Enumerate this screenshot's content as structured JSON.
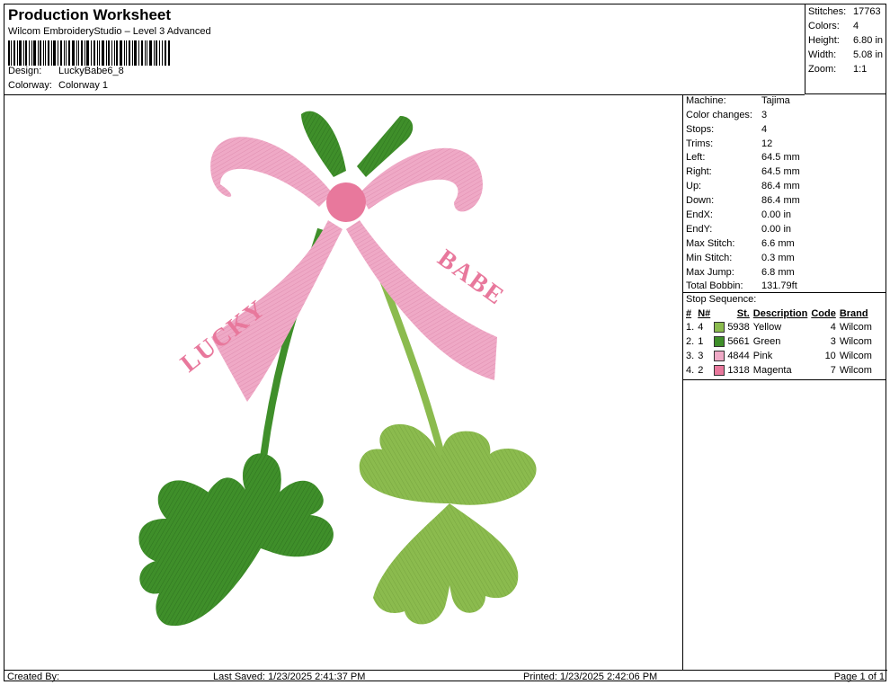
{
  "header": {
    "title": "Production Worksheet",
    "subtitle": "Wilcom EmbroideryStudio – Level 3 Advanced",
    "design_label": "Design:",
    "design_value": "LuckyBabe6_8",
    "colorway_label": "Colorway:",
    "colorway_value": "Colorway 1"
  },
  "stats": [
    {
      "label": "Stitches:",
      "value": "17763"
    },
    {
      "label": "Colors:",
      "value": "4"
    },
    {
      "label": "Height:",
      "value": "6.80 in"
    },
    {
      "label": "Width:",
      "value": "5.08 in"
    },
    {
      "label": "Zoom:",
      "value": "1:1"
    }
  ],
  "machine_info": [
    {
      "label": "Machine:",
      "value": "Tajima"
    },
    {
      "label": "Color changes:",
      "value": "3"
    },
    {
      "label": "Stops:",
      "value": "4"
    },
    {
      "label": "Trims:",
      "value": "12"
    },
    {
      "label": "Left:",
      "value": "64.5 mm"
    },
    {
      "label": "Right:",
      "value": "64.5 mm"
    },
    {
      "label": "Up:",
      "value": "86.4 mm"
    },
    {
      "label": "Down:",
      "value": "86.4 mm"
    },
    {
      "label": "EndX:",
      "value": "0.00 in"
    },
    {
      "label": "EndY:",
      "value": "0.00 in"
    },
    {
      "label": "Max Stitch:",
      "value": "6.6 mm"
    },
    {
      "label": "Min Stitch:",
      "value": "0.3 mm"
    },
    {
      "label": "Max Jump:",
      "value": "6.8 mm"
    },
    {
      "label": "Total Bobbin:",
      "value": "131.79ft"
    }
  ],
  "stop_sequence": {
    "title": "Stop Sequence:",
    "columns": [
      "#",
      "N#",
      "St.",
      "Description",
      "Code",
      "Brand"
    ],
    "rows": [
      {
        "idx": "1.",
        "n": "4",
        "color": "#8bbb4e",
        "st": "5938",
        "desc": "Yellow",
        "code": "4",
        "brand": "Wilcom"
      },
      {
        "idx": "2.",
        "n": "1",
        "color": "#3f8f2a",
        "st": "5661",
        "desc": "Green",
        "code": "3",
        "brand": "Wilcom"
      },
      {
        "idx": "3.",
        "n": "3",
        "color": "#efa9c6",
        "st": "4844",
        "desc": "Pink",
        "code": "10",
        "brand": "Wilcom"
      },
      {
        "idx": "4.",
        "n": "2",
        "color": "#e8789c",
        "st": "1318",
        "desc": "Magenta",
        "code": "7",
        "brand": "Wilcom"
      }
    ]
  },
  "design_text": {
    "left": "LUCKY",
    "right": "BABE"
  },
  "footer": {
    "created_by": "Created By:",
    "last_saved": "Last Saved: 1/23/2025 2:41:37 PM",
    "printed": "Printed: 1/23/2025 2:42:06 PM",
    "page": "Page 1 of 1"
  }
}
